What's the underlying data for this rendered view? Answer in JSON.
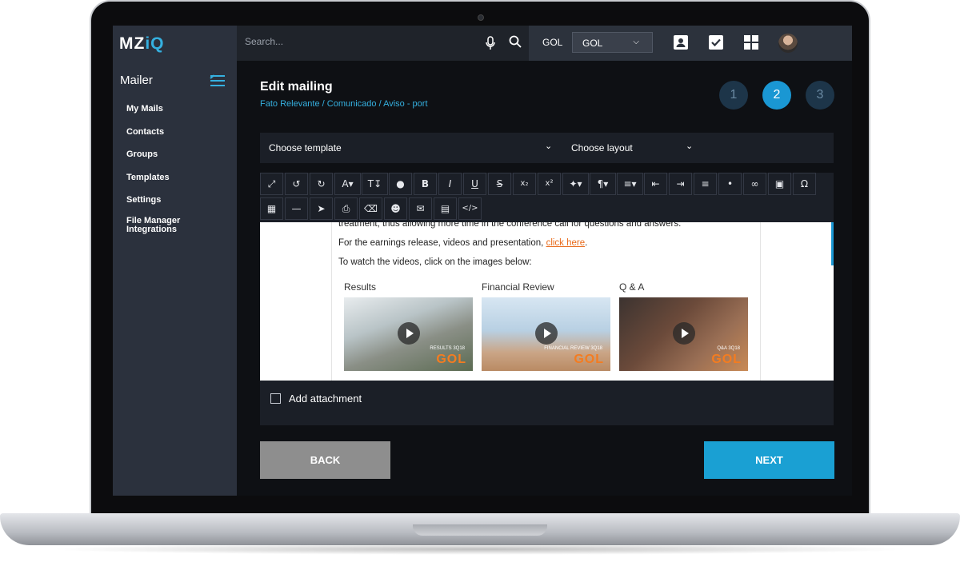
{
  "app": {
    "logo_main": "MZ",
    "logo_accent": "iQ"
  },
  "sidebar": {
    "title": "Mailer",
    "items": [
      {
        "label": "My Mails"
      },
      {
        "label": "Contacts"
      },
      {
        "label": "Groups"
      },
      {
        "label": "Templates"
      },
      {
        "label": "Settings"
      },
      {
        "label": "File Manager"
      },
      {
        "label": "Integrations"
      }
    ]
  },
  "topbar": {
    "search_placeholder": "Search...",
    "company_label": "GOL",
    "company_selected": "GOL",
    "icons": [
      "microphone-icon",
      "search-icon",
      "contact-card-icon",
      "checkbox-icon",
      "grid-icon",
      "avatar"
    ]
  },
  "page": {
    "title": "Edit mailing",
    "subtitle": "Fato Relevante / Comunicado / Aviso - port",
    "steps": [
      "1",
      "2",
      "3"
    ],
    "active_step": 2
  },
  "selectors": {
    "template_placeholder": "Choose template",
    "layout_placeholder": "Choose layout"
  },
  "editor": {
    "toolbar_row1": [
      "fullscreen-icon",
      "undo-icon",
      "redo-icon",
      "font-color-icon",
      "font-size-icon",
      "color-drop-icon",
      "bold-icon",
      "italic-icon",
      "underline-icon",
      "strikethrough-icon",
      "subscript-icon",
      "superscript-icon",
      "format-painter-icon",
      "paragraph-icon",
      "align-icon",
      "outdent-icon",
      "indent-icon",
      "ordered-list-icon",
      "unordered-list-icon",
      "link-icon",
      "image-icon",
      "special-char-icon"
    ],
    "toolbar_row2": [
      "table-icon",
      "horizontal-rule-icon",
      "select-icon",
      "print-icon",
      "eraser-icon",
      "add-user-icon",
      "email-icon",
      "document-icon",
      "code-view-icon"
    ],
    "line1": "treatment, thus allowing more time in the conference call for questions and answers.",
    "line2_prefix": "For the earnings release, videos and presentation, ",
    "line2_link": "click here",
    "line2_suffix": ".",
    "line3": "To watch the videos, click on the images below:",
    "videos": [
      {
        "label": "Results",
        "caption": "RESULTS 3Q18",
        "brand": "GOL"
      },
      {
        "label": "Financial Review",
        "caption": "FINANCIAL REVIEW 3Q18",
        "brand": "GOL"
      },
      {
        "label": "Q & A",
        "caption": "Q&A 3Q18",
        "brand": "GOL"
      }
    ]
  },
  "attachment": {
    "label": "Add attachment",
    "checked": false
  },
  "buttons": {
    "back": "BACK",
    "next": "NEXT"
  },
  "colors": {
    "accent": "#1aa0d3",
    "sidebar": "#2b313d",
    "background": "#0e1014",
    "link": "#e86b1c"
  }
}
